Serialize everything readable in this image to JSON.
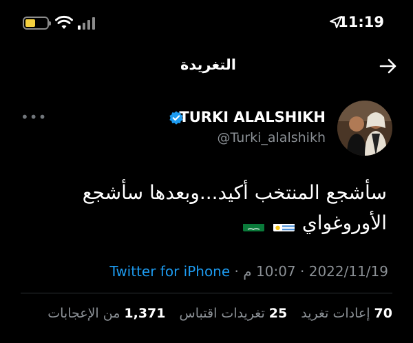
{
  "status_bar": {
    "time": "11:19",
    "battery_level": 0.35,
    "icons": [
      "battery-icon",
      "wifi-icon",
      "signal-icon",
      "location-arrow-icon"
    ]
  },
  "header": {
    "title": "التغريدة",
    "back_icon": "arrow-right-icon"
  },
  "author": {
    "name": "TURKI ALALSHIKH",
    "handle": "@Turki_alalshikh",
    "verified": true,
    "more_icon": "more-dots-icon"
  },
  "tweet": {
    "line1": "سأشجع المنتخب أكيد...وبعدها سأشجع",
    "line2": "الأوروغواي",
    "flags": [
      "uruguay-flag-icon",
      "saudi-flag-icon"
    ]
  },
  "meta": {
    "time": "10:07 م",
    "date": "2022/11/19",
    "separator": "·",
    "source": "Twitter for iPhone"
  },
  "stats": {
    "retweets_count": "70",
    "retweets_label": "إعادات تغريد",
    "quotes_count": "25",
    "quotes_label": "تغريدات اقتباس",
    "likes_count": "1,371",
    "likes_label": "من الإعجابات"
  },
  "colors": {
    "background": "#000000",
    "text": "#ffffff",
    "secondary": "#8b9095",
    "link": "#1d9bf0",
    "verified": "#1d9bf0"
  }
}
